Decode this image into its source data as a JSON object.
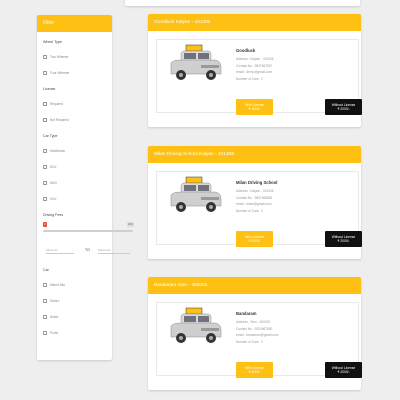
{
  "filter": {
    "title": "Filter",
    "sections": [
      {
        "title": "Wheel Type",
        "options": [
          "Two Wheeler",
          "Four Wheeler"
        ]
      },
      {
        "title": "License",
        "options": [
          "Required",
          "Not Required"
        ]
      },
      {
        "title": "Car Type",
        "options": [
          "Hatchback",
          "SUV",
          "MUV",
          "XUV"
        ]
      }
    ],
    "driving_fees": {
      "title": "Driving Fees",
      "min_label": "0",
      "max_label": "100",
      "min_placeholder": "Minimum",
      "to_label": "TO",
      "max_placeholder": "Maximum"
    },
    "car": {
      "title": "Car",
      "options": [
        "Maruti Alto",
        "Santro",
        "Nokia",
        "Punto"
      ]
    }
  },
  "listings": [
    {
      "header": "Goodluck Kalyan - 421306",
      "name": "Goodluck",
      "address": "Address : Kalyan - 421306",
      "contact": "Contact No : 9837567547",
      "email": "email : demo@gmail.com",
      "cars": "Number of Cars : 2",
      "with_license_label": "With License",
      "with_license_price": "₹ 3000/-",
      "without_license_label": "Without License",
      "without_license_price": "₹ 2000/-"
    },
    {
      "header": "Milan Driving School Kalyan - 421306",
      "name": "Milan Driving School",
      "address": "Address : Kalyan - 421306",
      "contact": "Contact No : 9837568818",
      "email": "email : milan@gmail.com",
      "cars": "Number of Cars : 3",
      "with_license_label": "With License",
      "with_license_price": "₹ 2500/-",
      "without_license_label": "Without License",
      "without_license_price": "₹ 2000/-"
    },
    {
      "header": "Bandaram Sion - 400022",
      "name": "Bandaram",
      "address": "Address : Sion - 400022",
      "contact": "Contact No : 9324567890",
      "email": "email : bandaram@gmail.com",
      "cars": "Number of Cars : 2",
      "with_license_label": "With License",
      "with_license_price": "₹ 3000/-",
      "without_license_label": "Without License",
      "without_license_price": "₹ 2000/-"
    }
  ],
  "colors": {
    "accent": "#fdc013",
    "dark_button": "#111111",
    "range_handle": "#e74c3c"
  }
}
